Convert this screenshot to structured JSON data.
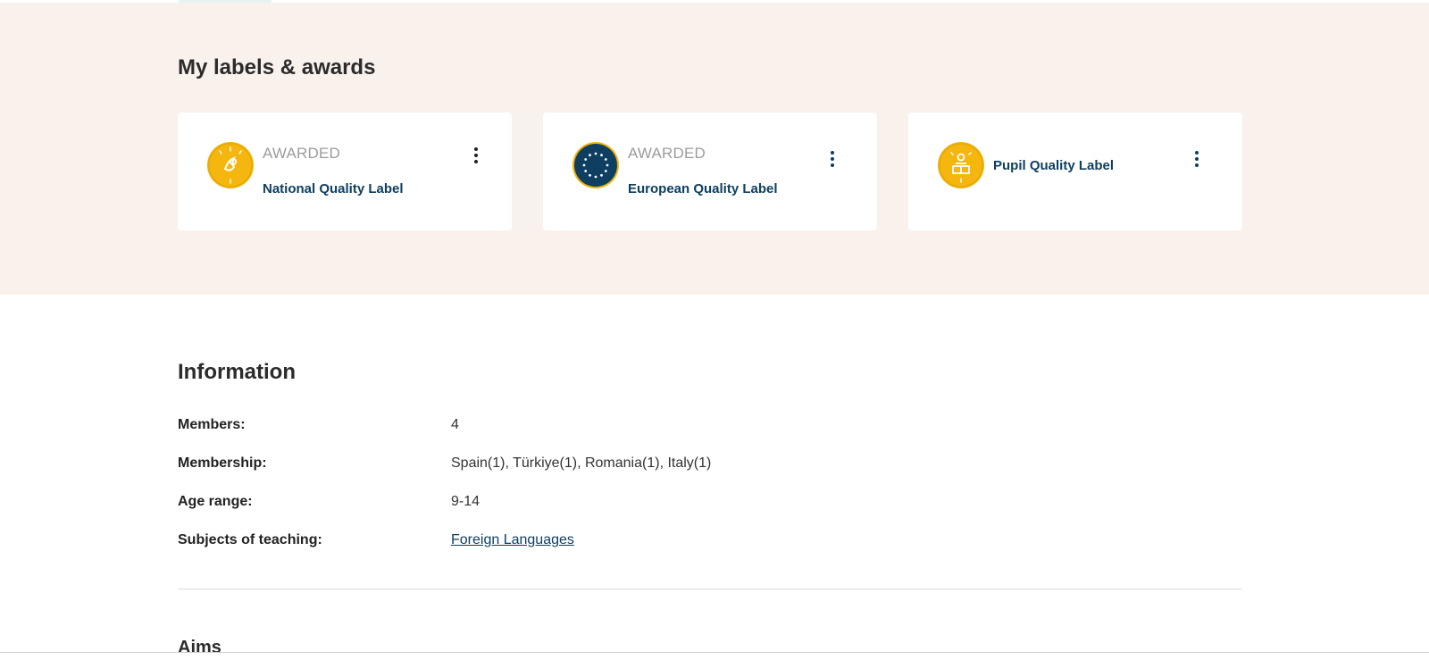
{
  "awards": {
    "title": "My labels & awards",
    "cards": [
      {
        "status": "AWARDED",
        "name": "National Quality Label",
        "icon": "national-quality-label-badge-icon"
      },
      {
        "status": "AWARDED",
        "name": "European Quality Label",
        "icon": "european-quality-label-badge-icon"
      },
      {
        "status": "",
        "name": "Pupil Quality Label",
        "icon": "pupil-quality-label-badge-icon"
      }
    ]
  },
  "information": {
    "title": "Information",
    "rows": [
      {
        "key": "Members:",
        "value": "4"
      },
      {
        "key": "Membership:",
        "value": "Spain(1), Türkiye(1), Romania(1), Italy(1)"
      },
      {
        "key": "Age range:",
        "value": "9-14"
      },
      {
        "key": "Subjects of teaching:",
        "value": "Foreign Languages"
      }
    ]
  },
  "aims": {
    "title": "Aims"
  },
  "colors": {
    "band_bg": "#f9f1ec",
    "badge_gold": "#f0b20d",
    "badge_navy": "#0e3f61",
    "link": "#0e3f61"
  }
}
